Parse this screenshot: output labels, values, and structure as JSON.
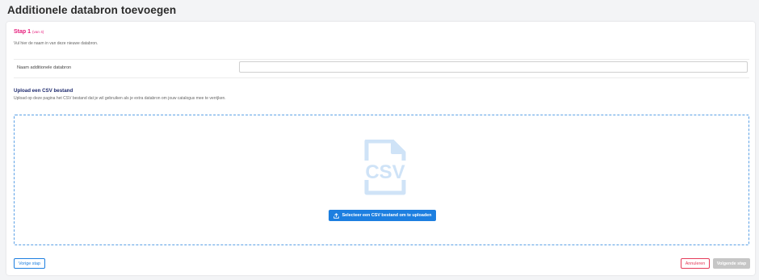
{
  "page": {
    "title": "Additionele databron toevoegen"
  },
  "step": {
    "label": "Stap 1",
    "sub": "(van 4)",
    "description": "Vul hier de naam in van deze nieuwe databron."
  },
  "form": {
    "name_label": "Naam additionele databron",
    "name_value": "",
    "name_placeholder": ""
  },
  "upload": {
    "title": "Upload een CSV bestand",
    "description": "Upload op deze pagina het CSV bestand dat je wil gebruiken als je extra databron om jouw catalogus mee te verrijken.",
    "icon_text": "CSV",
    "icon": "csv-file-icon",
    "button_label": "Selecteer een CSV bestand om te uploaden",
    "button_icon": "upload-icon"
  },
  "footer": {
    "prev_label": "Vorige stap",
    "cancel_label": "Annuleren",
    "next_label": "Volgende stap"
  },
  "colors": {
    "accent": "#1d7fe0",
    "step": "#e6197a",
    "cancel": "#e53b5a",
    "disabled": "#c6c6c6",
    "csv_icon": "#cfe3f7"
  }
}
